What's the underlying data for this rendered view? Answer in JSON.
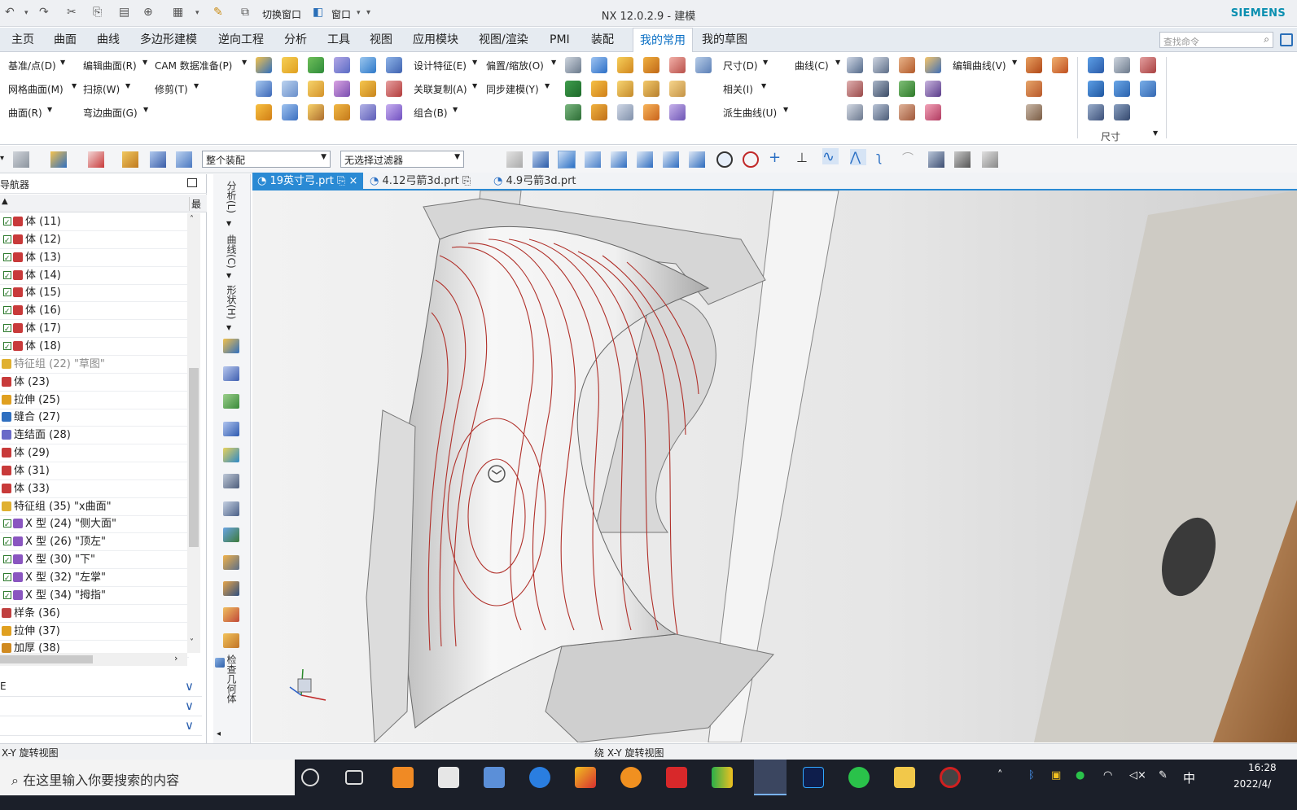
{
  "window": {
    "title": "NX 12.0.2.9 - 建模",
    "brand": "SIEMENS"
  },
  "quick_access": {
    "switch_window": "切换窗口",
    "window": "窗口"
  },
  "menu_tabs": [
    "主页",
    "曲面",
    "曲线",
    "多边形建模",
    "逆向工程",
    "分析",
    "工具",
    "视图",
    "应用模块",
    "视图/渲染",
    "PMI",
    "装配",
    "我的常用",
    "我的草图"
  ],
  "active_tab": "我的常用",
  "search": {
    "placeholder": "查找命令"
  },
  "ribbon": {
    "datum": "基准/点(D)",
    "edit_surface": "编辑曲面(R)",
    "cam_prep": "CAM 数据准备(P)",
    "mesh_surface": "网格曲面(M)",
    "sweep": "扫掠(W)",
    "trim": "修剪(T)",
    "surface": "曲面(R)",
    "flange_surface": "弯边曲面(G)",
    "design_feature": "设计特征(E)",
    "offset_scale": "偏置/缩放(O)",
    "associative_copy": "关联复制(A)",
    "sync_modeling": "同步建模(Y)",
    "combine": "组合(B)",
    "dimension": "尺寸(D)",
    "relation": "相关(I)",
    "curve": "曲线(C)",
    "edit_curve": "编辑曲线(V)",
    "derived_curve": "派生曲线(U)",
    "dimension_group": "尺寸"
  },
  "toolbar": {
    "assembly_filter": "整个装配",
    "selection_filter": "无选择过滤器"
  },
  "navigator": {
    "title": "导航器",
    "col_last": "最",
    "rows": [
      {
        "label": "体 (11)",
        "check": true,
        "gray": false
      },
      {
        "label": "体 (12)",
        "check": true,
        "gray": false
      },
      {
        "label": "体 (13)",
        "check": true,
        "gray": false
      },
      {
        "label": "体 (14)",
        "check": true,
        "gray": false
      },
      {
        "label": "体 (15)",
        "check": true,
        "gray": false
      },
      {
        "label": "体 (16)",
        "check": true,
        "gray": false
      },
      {
        "label": "体 (17)",
        "check": true,
        "gray": false
      },
      {
        "label": "体 (18)",
        "check": true,
        "gray": false
      },
      {
        "label": "特征组 (22) \"草图\"",
        "check": false,
        "gray": true
      },
      {
        "label": "体 (23)",
        "check": false,
        "gray": false
      },
      {
        "label": "拉伸 (25)",
        "check": false,
        "gray": false
      },
      {
        "label": "缝合 (27)",
        "check": false,
        "gray": false
      },
      {
        "label": "连结面 (28)",
        "check": false,
        "gray": false
      },
      {
        "label": "体 (29)",
        "check": false,
        "gray": false
      },
      {
        "label": "体 (31)",
        "check": false,
        "gray": false
      },
      {
        "label": "体 (33)",
        "check": false,
        "gray": false
      },
      {
        "label": "特征组 (35) \"x曲面\"",
        "check": false,
        "gray": false
      },
      {
        "label": "X 型 (24) \"侧大面\"",
        "check": true,
        "gray": false
      },
      {
        "label": "X 型 (26) \"顶左\"",
        "check": true,
        "gray": false
      },
      {
        "label": "X 型 (30) \"下\"",
        "check": true,
        "gray": false
      },
      {
        "label": "X 型 (32) \"左掌\"",
        "check": true,
        "gray": false
      },
      {
        "label": "X 型 (34) \"拇指\"",
        "check": true,
        "gray": false
      },
      {
        "label": "样条 (36)",
        "check": false,
        "gray": false
      },
      {
        "label": "拉伸 (37)",
        "check": false,
        "gray": false
      },
      {
        "label": "加厚 (38)",
        "check": false,
        "gray": false
      }
    ],
    "section1": "E"
  },
  "vertical_strip": {
    "analysis": "分析(L)",
    "curve": "曲线(C)",
    "shape": "形状(H)",
    "check_geometry": "检查几何体"
  },
  "doc_tabs": [
    "19英寸弓.prt",
    "4.12弓箭3d.prt",
    "4.9弓箭3d.prt"
  ],
  "status": {
    "left": "X-Y 旋转视图",
    "center": "绕 X-Y 旋转视图"
  },
  "taskbar": {
    "search_placeholder": "在这里输入你要搜索的内容",
    "time": "16:28",
    "date": "2022/4/",
    "ime": "中"
  },
  "colors": {
    "accent": "#2a8ad4",
    "brand": "#0a8fb0",
    "curve": "#b0302a"
  }
}
